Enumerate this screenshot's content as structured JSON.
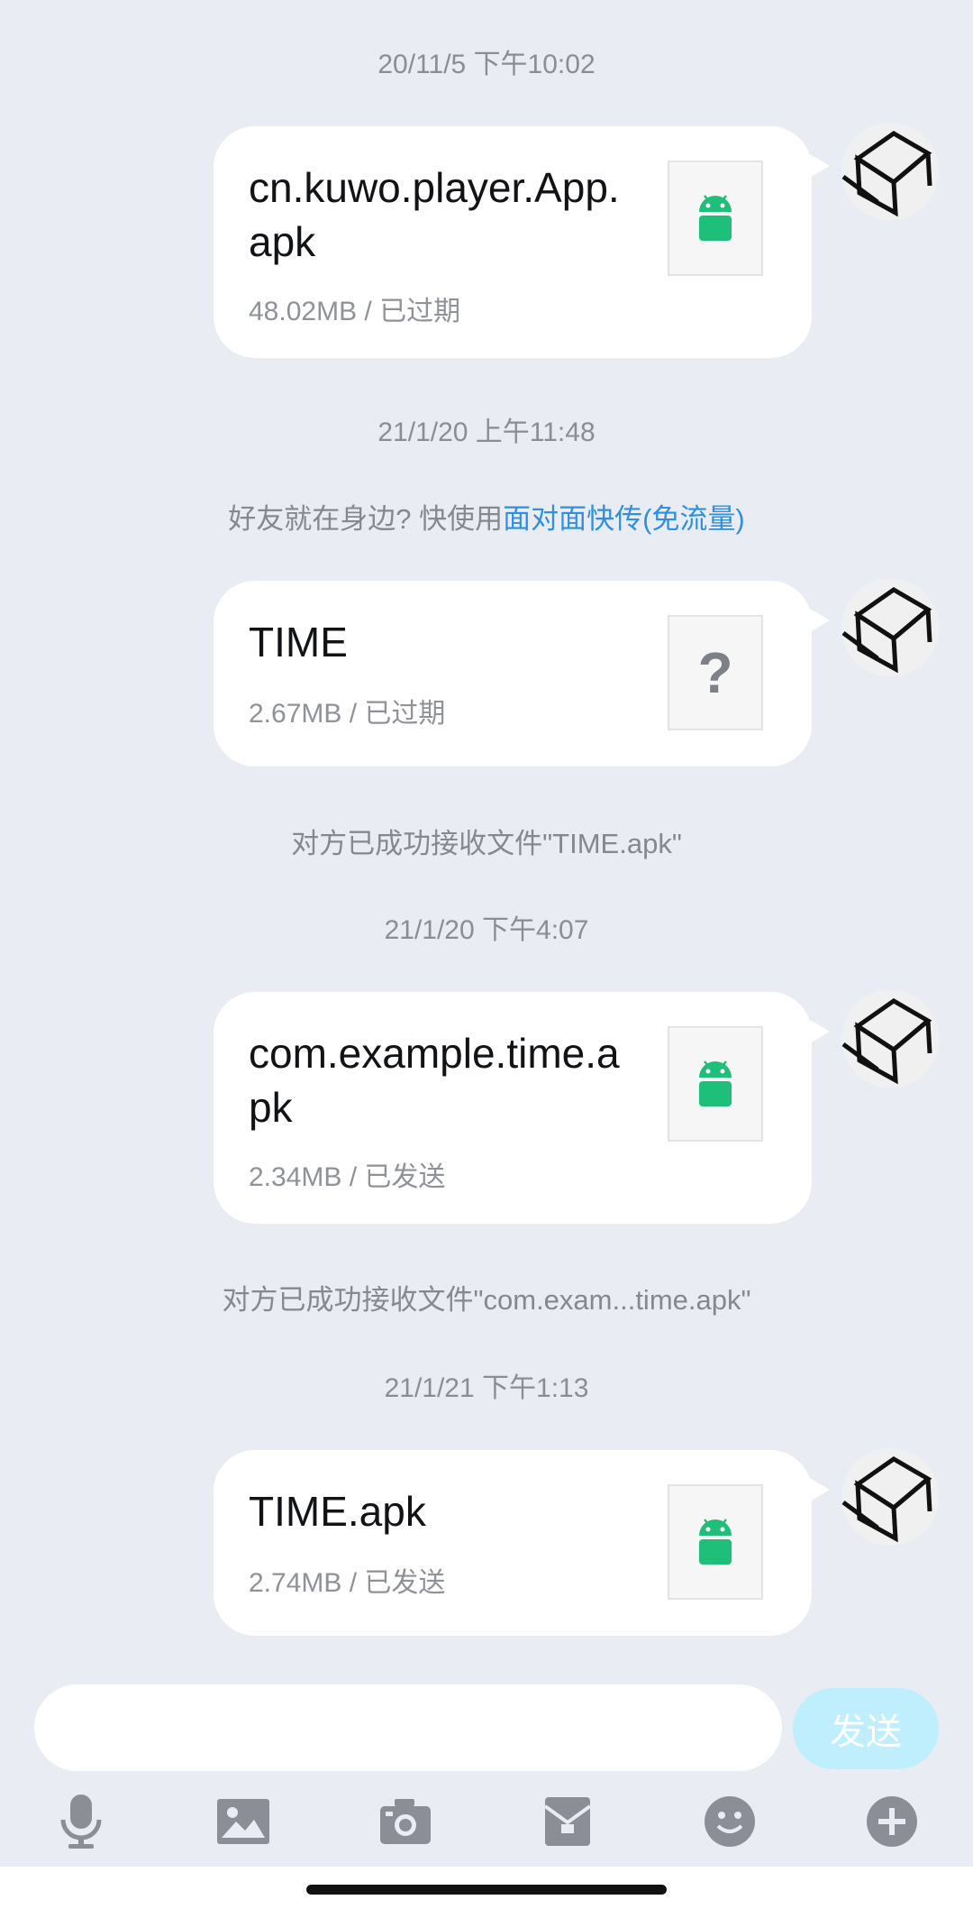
{
  "timestamps": [
    "20/11/5 下午10:02",
    "21/1/20 上午11:48",
    "21/1/20 下午4:07",
    "21/1/21 下午1:13"
  ],
  "system_messages": {
    "nearby_prefix": "好友就在身边? 快使用",
    "nearby_link": "面对面快传(免流量)",
    "received_1": "对方已成功接收文件\"TIME.apk\"",
    "received_2": "对方已成功接收文件\"com.exam...time.apk\""
  },
  "messages": [
    {
      "name": "cn.kuwo.player.App.apk",
      "meta": "48.02MB / 已过期",
      "icon": "android-icon"
    },
    {
      "name": "TIME",
      "meta": "2.67MB / 已过期",
      "icon": "unknown-file-icon",
      "mark": "?"
    },
    {
      "name": "com.example.time.apk",
      "meta": "2.34MB / 已发送",
      "icon": "android-icon"
    },
    {
      "name": "TIME.apk",
      "meta": "2.74MB / 已发送",
      "icon": "android-icon"
    }
  ],
  "composer": {
    "input_value": "",
    "send_label": "发送"
  },
  "toolbar": [
    "microphone-icon",
    "image-icon",
    "camera-icon",
    "file-box-icon",
    "emoji-icon",
    "plus-icon"
  ],
  "colors": {
    "background": "#eaecf3",
    "bubble": "#ffffff",
    "android_green": "#1fbf7a",
    "link_blue": "#2f8fe0",
    "send_button": "#bfeefc",
    "toolbar_icon": "#8b8e96"
  }
}
